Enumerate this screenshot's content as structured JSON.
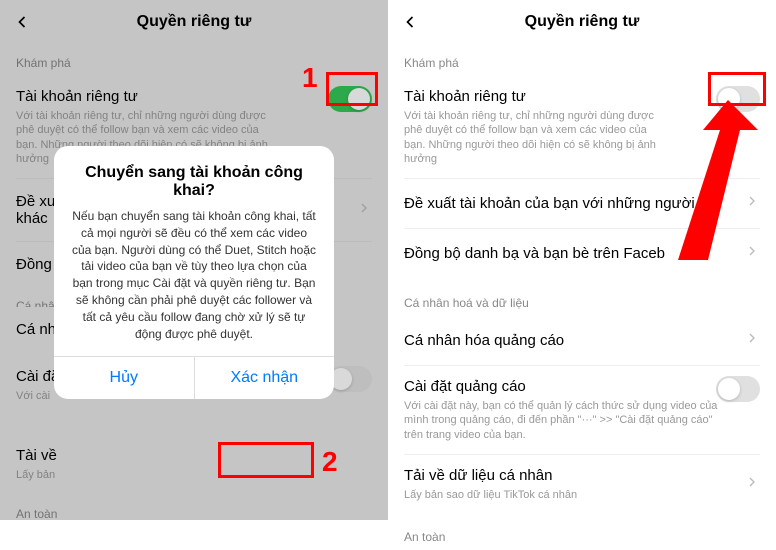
{
  "header": {
    "title": "Quyền riêng tư"
  },
  "sections": {
    "discover": "Khám phá",
    "personalize": "Cá nhân hoá và dữ liệu",
    "safety": "An toàn"
  },
  "privacy": {
    "title": "Tài khoản riêng tư",
    "desc": "Với tài khoản riêng tư, chỉ những người dùng được phê duyệt có thể follow bạn và xem các video của bạn. Những người theo dõi hiện có sẽ không bị ảnh hưởng"
  },
  "items": {
    "suggest": "Đề xuất tài khoản của bạn với những người khác",
    "suggest_short": "Đề xuất tài khoản của bạn với những người k...",
    "sync": "Đồng bộ",
    "sync_full": "Đồng bộ danh bạ và bạn bè trên Faceb",
    "personalize_truncated": "Cá nhân ho",
    "personalize_left": "Cá nhân",
    "personalize_ads": "Cá nhân hóa quảng cáo",
    "ad_settings_title": "Cài đặt quảng cáo",
    "ad_settings_title_short": "Cài đặt",
    "ad_settings_desc": "Với cài đặt này, bạn có thể quản lý cách thức sử dụng video của mình trong quảng cáo, đi đến phần \"···\" >> \"Cài đặt quảng cáo\" trên trang video của bạn.",
    "download_title": "Tải về dữ liệu cá nhân",
    "download_title_short": "Tài về",
    "download_desc": "Lấy bản sao dữ liệu TikTok cá nhân",
    "download_desc_short": "Lấy bản"
  },
  "modal": {
    "title": "Chuyển sang tài khoản công khai?",
    "body": "Nếu bạn chuyển sang tài khoản công khai, tất cả mọi người sẽ đều có thể xem các video của bạn. Người dùng có thể Duet, Stitch hoặc tải video của bạn về tùy theo lựa chọn của bạn trong mục Cài đặt và quyền riêng tư. Bạn sẽ không cần phải phê duyệt các follower và tất cả yêu cầu follow đang chờ xử lý sẽ tự động được phê duyệt.",
    "cancel": "Hủy",
    "confirm": "Xác nhận"
  },
  "annotations": {
    "num1": "1",
    "num2": "2"
  }
}
